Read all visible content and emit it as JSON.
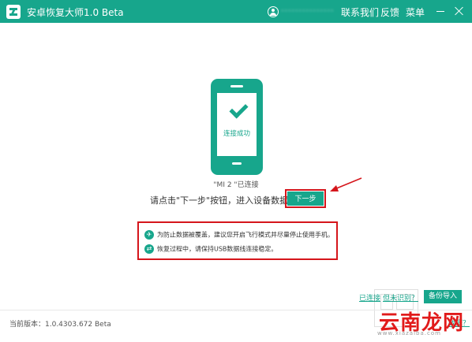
{
  "window": {
    "title": "安卓恢复大师1.0 Beta",
    "user_name": "···············",
    "menu": [
      "联系我们",
      "反馈",
      "菜单"
    ]
  },
  "main": {
    "screen_text": "连接成功",
    "device_status": "\"MI 2 \"已连接",
    "instruction": "请点击\"下一步\"按钮，进入设备数据扫描",
    "next_button": "下一步",
    "tips": [
      {
        "icon": "airplane-icon",
        "text": "为防止数据被覆盖，建议您开启飞行模式并尽量停止使用手机。"
      },
      {
        "icon": "usb-icon",
        "text": "恢复过程中，请保持USB数据线连接稳定。"
      }
    ],
    "links": {
      "connected": "已连接",
      "unrecognized": "但未识别？"
    },
    "backup_button": "备份导入"
  },
  "footer": {
    "version": "当前版本：1.0.4303.672 Beta",
    "tail_link": "数据？"
  },
  "watermark": {
    "title": "云南龙网",
    "url": "www.xiazaiba.com"
  },
  "colors": {
    "accent": "#17a68c",
    "highlight": "#d5151b"
  }
}
